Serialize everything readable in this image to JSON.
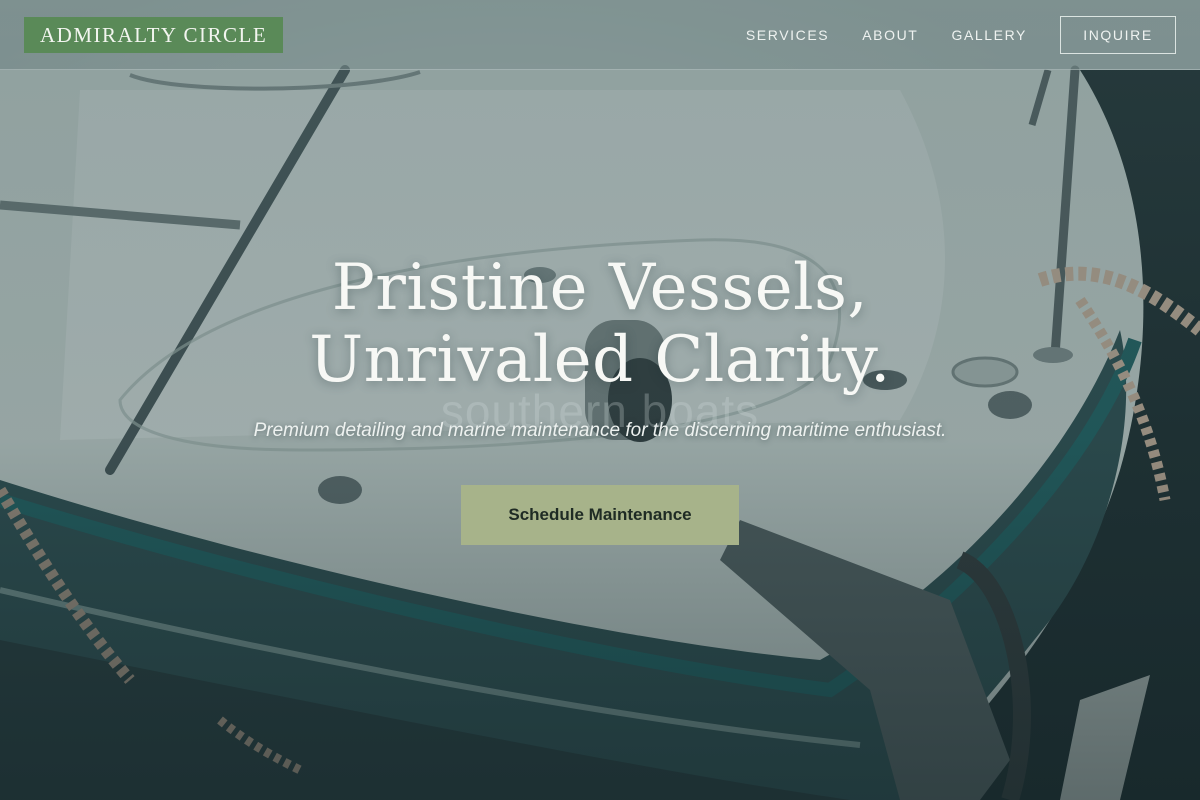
{
  "header": {
    "brand": "ADMIRALTY CIRCLE",
    "nav": [
      {
        "label": "SERVICES"
      },
      {
        "label": "ABOUT"
      },
      {
        "label": "GALLERY"
      }
    ],
    "cta_label": "INQUIRE"
  },
  "hero": {
    "title_line1": "Pristine Vessels,",
    "title_line2": "Unrivaled Clarity.",
    "watermark": "southern boats",
    "subtitle": "Premium detailing and marine maintenance for the discerning maritime enthusiast.",
    "cta_label": "Schedule Maintenance"
  },
  "colors": {
    "brand_bg": "#5a8a58",
    "cta_bg": "#a7b38a",
    "hull_stripe": "#1f5a5c"
  }
}
